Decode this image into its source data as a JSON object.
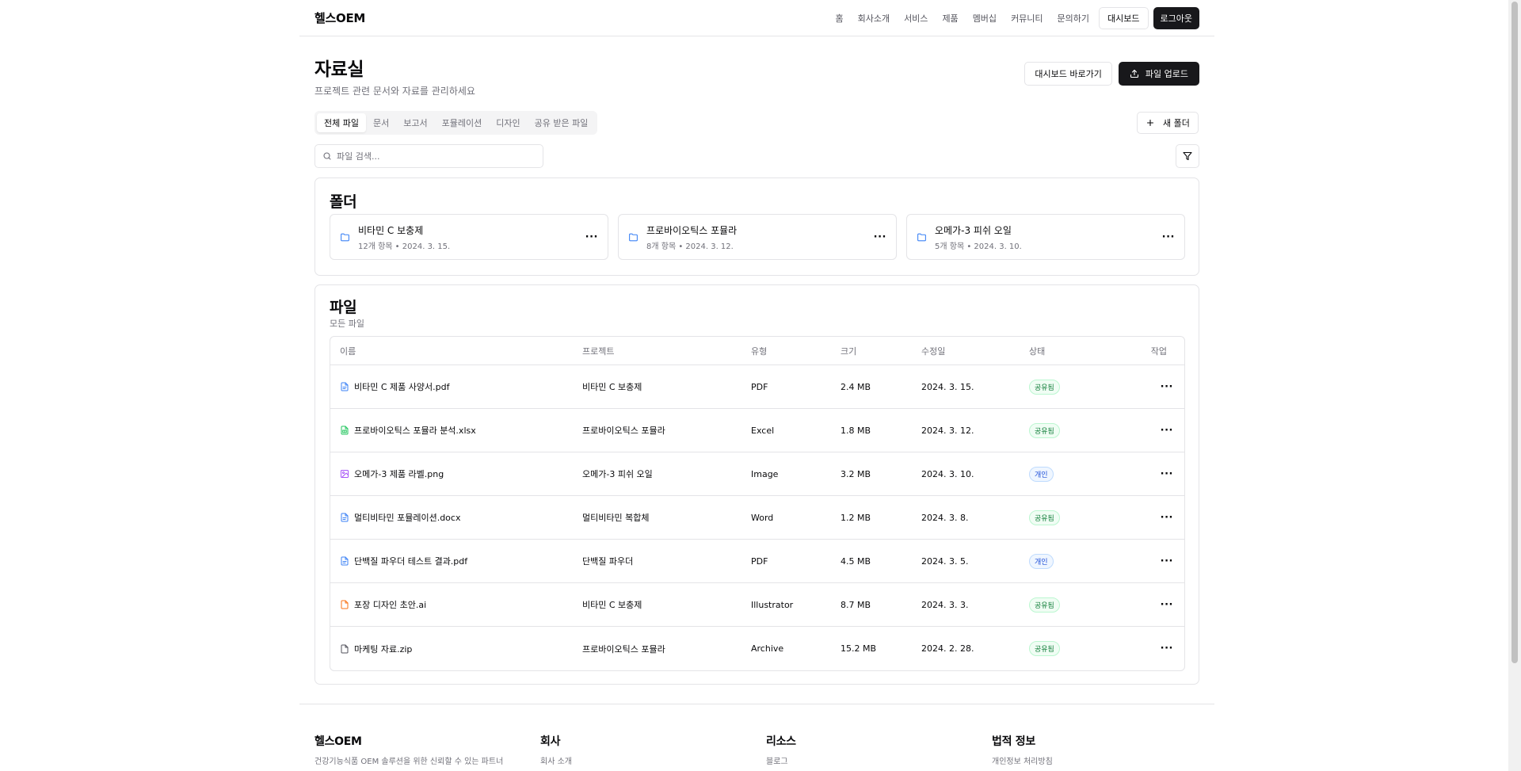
{
  "header": {
    "logo": "헬스OEM",
    "nav": [
      "홈",
      "회사소개",
      "서비스",
      "제품",
      "멤버십",
      "커뮤니티",
      "문의하기"
    ],
    "dashboard_label": "대시보드",
    "logout_label": "로그아웃"
  },
  "page": {
    "title": "자료실",
    "subtitle": "프로젝트 관련 문서와 자료를 관리하세요",
    "go_dashboard_label": "대시보드 바로가기",
    "upload_label": "파일 업로드"
  },
  "tabs": [
    "전체 파일",
    "문서",
    "보고서",
    "포뮬레이션",
    "디자인",
    "공유 받은 파일"
  ],
  "active_tab": "전체 파일",
  "new_folder_label": "새 폴더",
  "search": {
    "placeholder": "파일 검색..."
  },
  "folders_section": {
    "title": "폴더",
    "items": [
      {
        "name": "비타민 C 보충제",
        "meta": "12개 항목 • 2024. 3. 15."
      },
      {
        "name": "프로바이오틱스 포뮬라",
        "meta": "8개 항목 • 2024. 3. 12."
      },
      {
        "name": "오메가-3 피쉬 오일",
        "meta": "5개 항목 • 2024. 3. 10."
      }
    ]
  },
  "files_section": {
    "title": "파일",
    "description": "모든 파일",
    "columns": [
      "이름",
      "프로젝트",
      "유형",
      "크기",
      "수정일",
      "상태",
      "작업"
    ],
    "rows": [
      {
        "name": "비타민 C 제품 사양서.pdf",
        "project": "비타민 C 보충제",
        "type": "PDF",
        "size": "2.4 MB",
        "modified": "2024. 3. 15.",
        "status": "공유됨",
        "status_kind": "shared",
        "icon": "document-icon",
        "icon_color": "#3b82f6"
      },
      {
        "name": "프로바이오틱스 포뮬라 분석.xlsx",
        "project": "프로바이오틱스 포뮬라",
        "type": "Excel",
        "size": "1.8 MB",
        "modified": "2024. 3. 12.",
        "status": "공유됨",
        "status_kind": "shared",
        "icon": "spreadsheet-icon",
        "icon_color": "#22c55e"
      },
      {
        "name": "오메가-3 제품 라벨.png",
        "project": "오메가-3 피쉬 오일",
        "type": "Image",
        "size": "3.2 MB",
        "modified": "2024. 3. 10.",
        "status": "개인",
        "status_kind": "private",
        "icon": "image-icon",
        "icon_color": "#a855f7"
      },
      {
        "name": "멀티비타민 포뮬레이션.docx",
        "project": "멀티비타민 복합체",
        "type": "Word",
        "size": "1.2 MB",
        "modified": "2024. 3. 8.",
        "status": "공유됨",
        "status_kind": "shared",
        "icon": "document-icon",
        "icon_color": "#3b82f6"
      },
      {
        "name": "단백질 파우더 테스트 결과.pdf",
        "project": "단백질 파우더",
        "type": "PDF",
        "size": "4.5 MB",
        "modified": "2024. 3. 5.",
        "status": "개인",
        "status_kind": "private",
        "icon": "document-icon",
        "icon_color": "#3b82f6"
      },
      {
        "name": "포장 디자인 초안.ai",
        "project": "비타민 C 보충제",
        "type": "Illustrator",
        "size": "8.7 MB",
        "modified": "2024. 3. 3.",
        "status": "공유됨",
        "status_kind": "shared",
        "icon": "design-file-icon",
        "icon_color": "#f97316"
      },
      {
        "name": "마케팅 자료.zip",
        "project": "프로바이오틱스 포뮬라",
        "type": "Archive",
        "size": "15.2 MB",
        "modified": "2024. 2. 28.",
        "status": "공유됨",
        "status_kind": "shared",
        "icon": "file-icon",
        "icon_color": "#52525b"
      }
    ]
  },
  "footer": {
    "brand": {
      "title": "헬스OEM",
      "text": "건강기능식품 OEM 솔루션을 위한 신뢰할 수 있는 파트너"
    },
    "company": {
      "title": "회사",
      "first_link": "회사 소개"
    },
    "resources": {
      "title": "리소스",
      "first_link": "블로그"
    },
    "legal": {
      "title": "법적 정보",
      "first_link": "개인정보 처리방침"
    }
  }
}
